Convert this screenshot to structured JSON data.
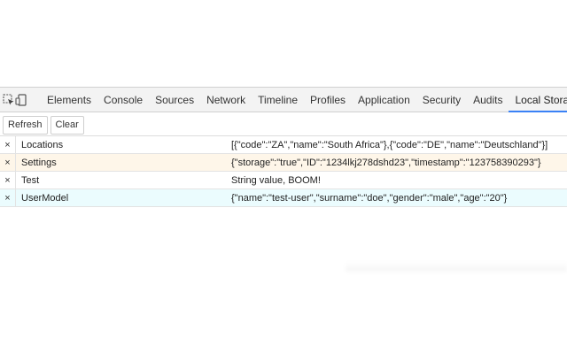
{
  "toolbar": {
    "tabs": [
      {
        "label": "Elements"
      },
      {
        "label": "Console"
      },
      {
        "label": "Sources"
      },
      {
        "label": "Network"
      },
      {
        "label": "Timeline"
      },
      {
        "label": "Profiles"
      },
      {
        "label": "Application"
      },
      {
        "label": "Security"
      },
      {
        "label": "Audits"
      },
      {
        "label": "Local Storage"
      }
    ],
    "active_tab": "Local Storage",
    "icons": [
      "inspect-element-icon",
      "device-mode-icon"
    ],
    "accent_color": "#3a82f6"
  },
  "actions": {
    "refresh_label": "Refresh",
    "clear_label": "Clear"
  },
  "storage": {
    "delete_glyph": "×",
    "rows": [
      {
        "key": "Locations",
        "value": "[{\"code\":\"ZA\",\"name\":\"South Africa\"},{\"code\":\"DE\",\"name\":\"Deutschland\"}]",
        "highlight": "none"
      },
      {
        "key": "Settings",
        "value": "{\"storage\":\"true\",\"ID\":\"1234lkj278dshd23\",\"timestamp\":\"123758390293\"}",
        "highlight": "#fef6e9"
      },
      {
        "key": "Test",
        "value": "String value, BOOM!",
        "highlight": "none"
      },
      {
        "key": "UserModel",
        "value": "{\"name\":\"test-user\",\"surname\":\"doe\",\"gender\":\"male\",\"age\":\"20\"}",
        "highlight": "#ebfcfe"
      }
    ]
  }
}
